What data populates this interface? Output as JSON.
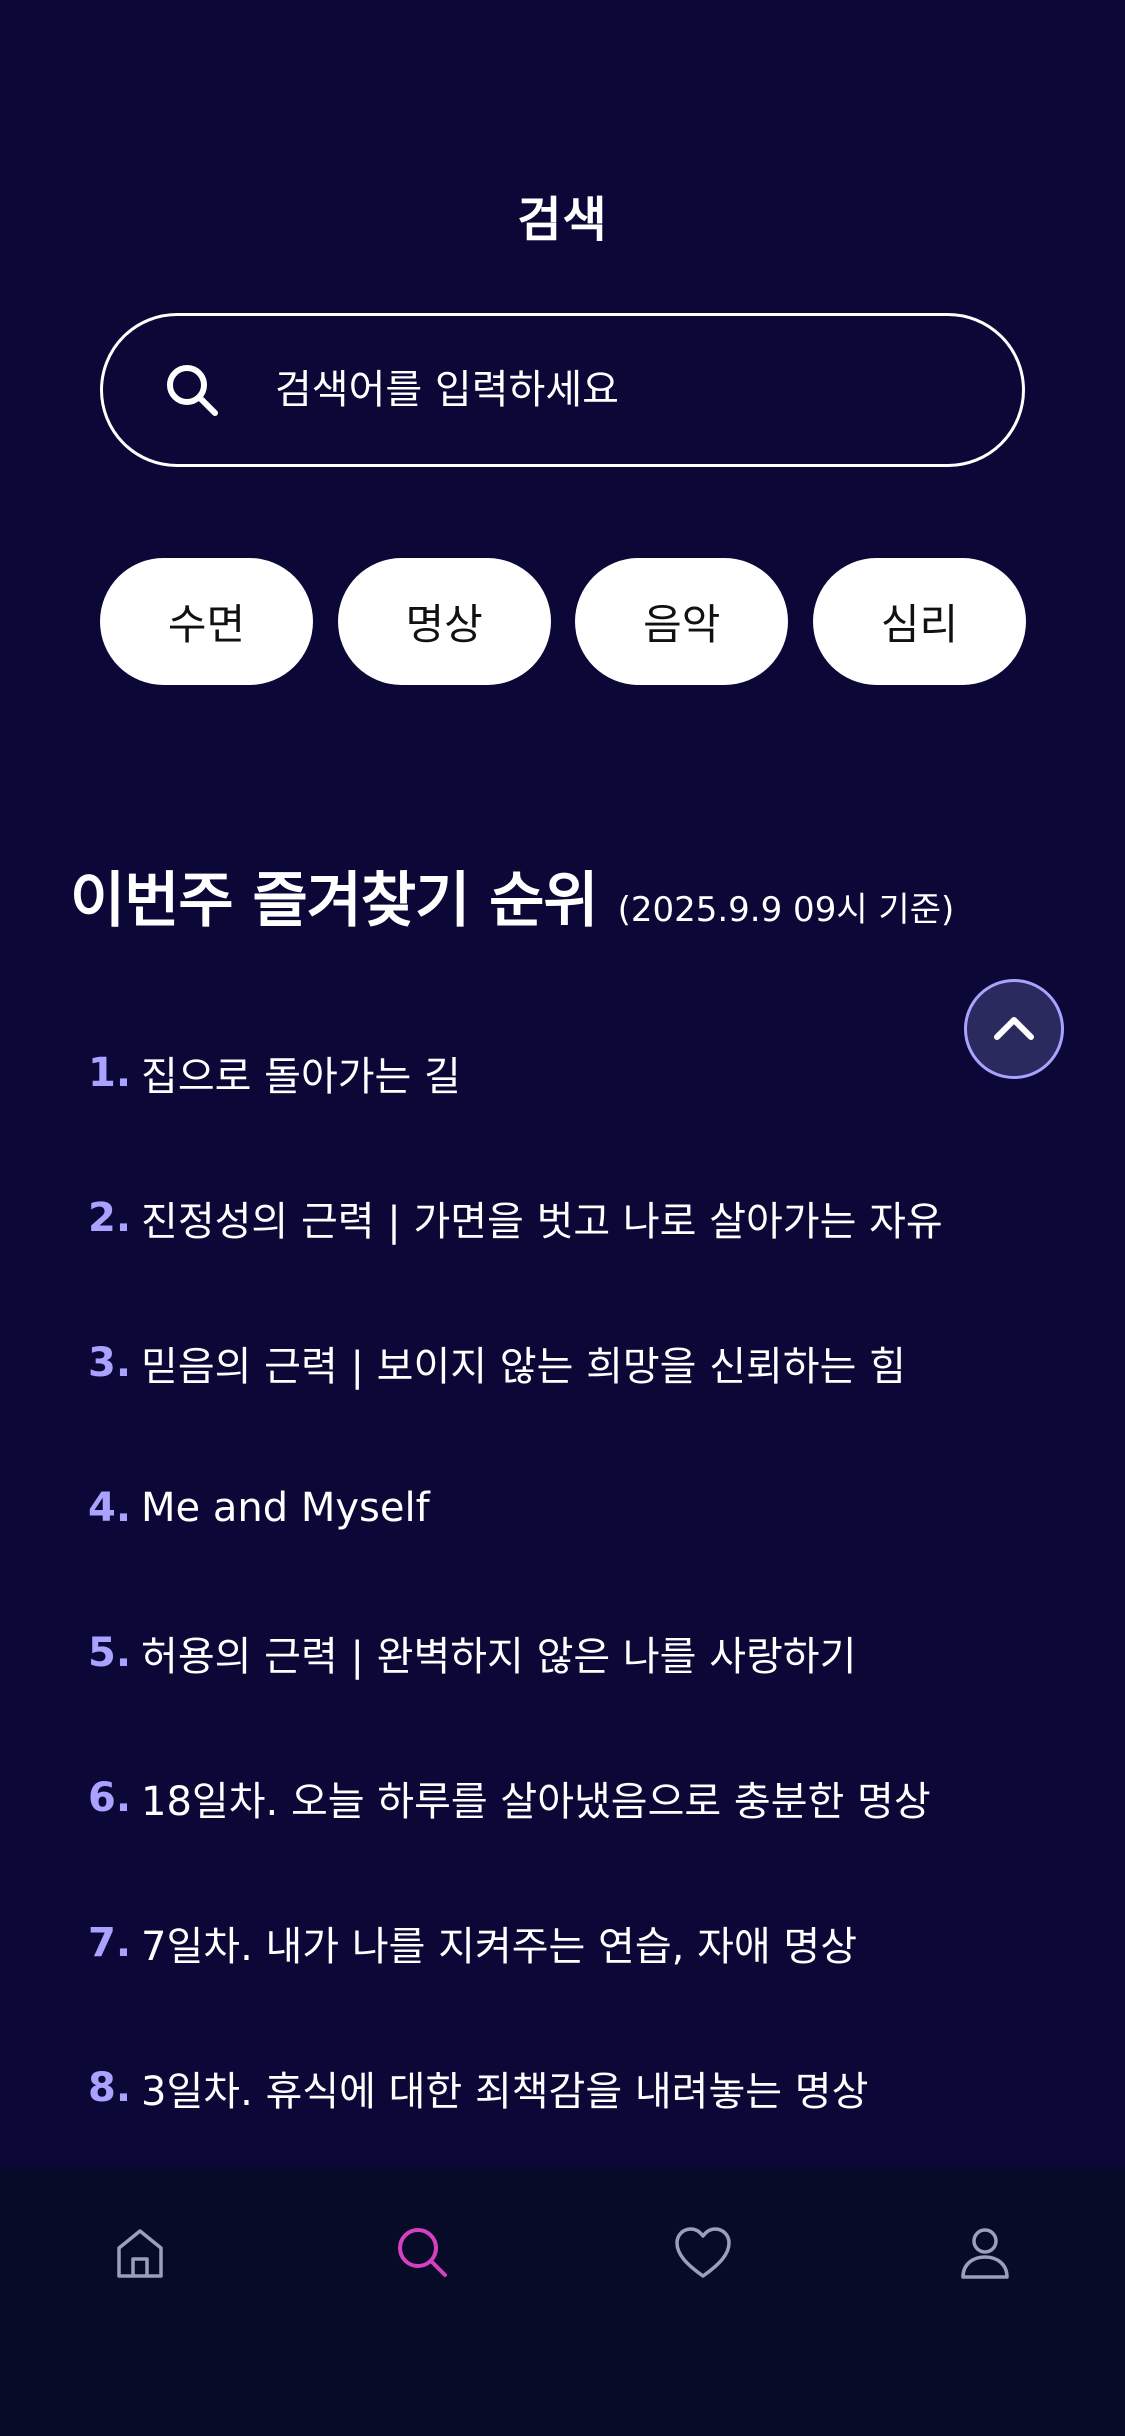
{
  "header": {
    "title": "검색"
  },
  "search": {
    "placeholder": "검색어를 입력하세요",
    "value": ""
  },
  "chips": [
    "수면",
    "명상",
    "음악",
    "심리"
  ],
  "ranking": {
    "title": "이번주 즐겨찾기 순위",
    "subtitle": "(2025.9.9 09시 기준)",
    "items": [
      {
        "num": "1.",
        "title": "집으로 돌아가는 길"
      },
      {
        "num": "2.",
        "title": "진정성의 근력 | 가면을 벗고 나로 살아가는 자유"
      },
      {
        "num": "3.",
        "title": "믿음의 근력 | 보이지 않는 희망을 신뢰하는 힘"
      },
      {
        "num": "4.",
        "title": "Me and Myself"
      },
      {
        "num": "5.",
        "title": "허용의 근력 | 완벽하지 않은 나를 사랑하기"
      },
      {
        "num": "6.",
        "title": "18일차. 오늘 하루를 살아냈음으로 충분한 명상"
      },
      {
        "num": "7.",
        "title": "7일차. 내가 나를 지켜주는 연습, 자애 명상"
      },
      {
        "num": "8.",
        "title": "3일차. 휴식에 대한 죄책감을 내려놓는 명상"
      }
    ]
  },
  "nav": {
    "items": [
      {
        "icon": "home-icon",
        "active": false
      },
      {
        "icon": "search-icon",
        "active": true
      },
      {
        "icon": "heart-icon",
        "active": false
      },
      {
        "icon": "user-icon",
        "active": false
      }
    ]
  },
  "colors": {
    "background": "#0b0838",
    "nav_background": "#070b28",
    "accent_number": "#a9a3ff",
    "active_nav": "#d63fbf",
    "inactive_nav": "#9aa0b8"
  }
}
